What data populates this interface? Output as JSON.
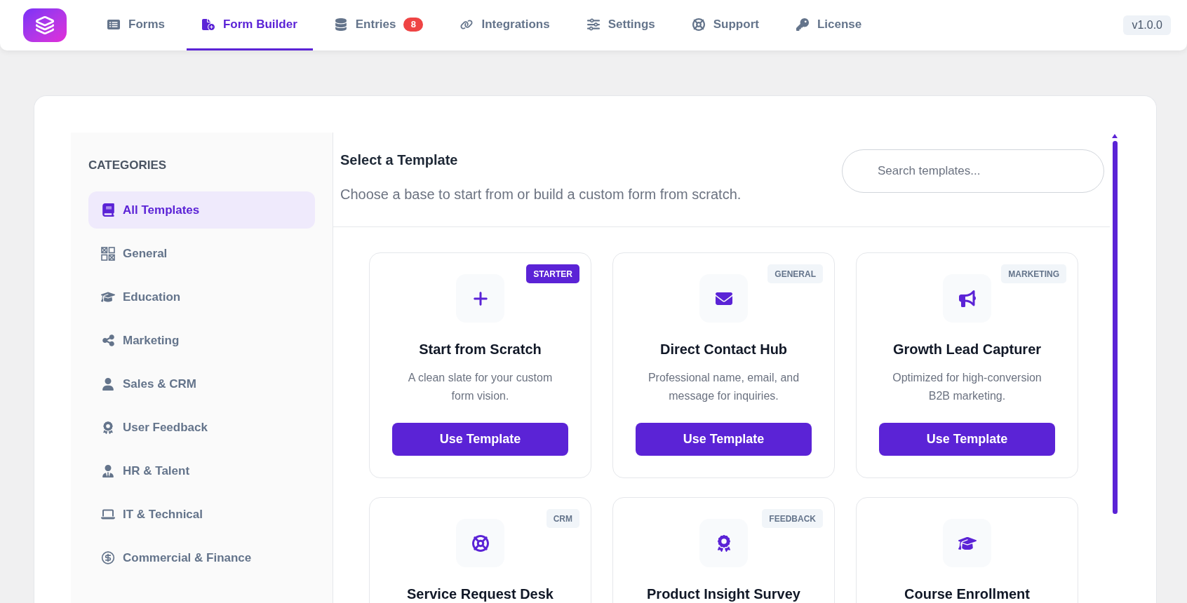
{
  "nav": {
    "tabs": [
      {
        "label": "Forms",
        "selected": false
      },
      {
        "label": "Form Builder",
        "selected": true
      },
      {
        "label": "Entries",
        "selected": false,
        "badge": "8"
      },
      {
        "label": "Integrations",
        "selected": false
      },
      {
        "label": "Settings",
        "selected": false
      },
      {
        "label": "Support",
        "selected": false
      },
      {
        "label": "License",
        "selected": false
      }
    ],
    "version": "v1.0.0"
  },
  "sidebar": {
    "heading": "CATEGORIES",
    "items": [
      {
        "label": "All Templates",
        "selected": true
      },
      {
        "label": "General",
        "selected": false
      },
      {
        "label": "Education",
        "selected": false
      },
      {
        "label": "Marketing",
        "selected": false
      },
      {
        "label": "Sales & CRM",
        "selected": false
      },
      {
        "label": "User Feedback",
        "selected": false
      },
      {
        "label": "HR & Talent",
        "selected": false
      },
      {
        "label": "IT & Technical",
        "selected": false
      },
      {
        "label": "Commercial & Finance",
        "selected": false
      }
    ]
  },
  "main": {
    "title": "Select a Template",
    "subtitle": "Choose a base to start from or build a custom form from scratch.",
    "search": {
      "placeholder": "Search templates..."
    },
    "templates": [
      {
        "title": "Start from Scratch",
        "description": "A clean slate for your custom form vision.",
        "badge": "STARTER",
        "featured": true,
        "button": "Use Template"
      },
      {
        "title": "Direct Contact Hub",
        "description": "Professional name, email, and message for inquiries.",
        "badge": "GENERAL",
        "featured": false,
        "button": "Use Template"
      },
      {
        "title": "Growth Lead Capturer",
        "description": "Optimized for high-conversion B2B marketing.",
        "badge": "MARKETING",
        "featured": false,
        "button": "Use Template"
      },
      {
        "title": "Service Request Desk",
        "badge": "CRM",
        "featured": false
      },
      {
        "title": "Product Insight Survey",
        "badge": "FEEDBACK",
        "featured": false
      },
      {
        "title": "Course Enrollment"
      }
    ]
  }
}
